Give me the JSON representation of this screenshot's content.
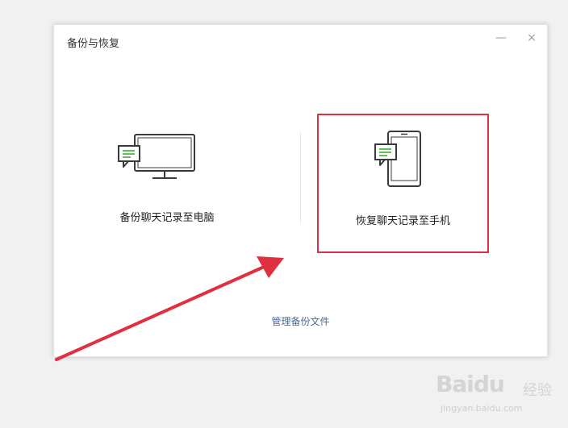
{
  "window": {
    "title": "备份与恢复",
    "minimize_glyph": "—",
    "close_glyph": "×"
  },
  "options": {
    "backup": {
      "label": "备份聊天记录至电脑",
      "icon": "monitor-chat-icon"
    },
    "restore": {
      "label": "恢复聊天记录至手机",
      "icon": "phone-chat-icon",
      "highlighted": true
    }
  },
  "manage_link": "管理备份文件",
  "annotation": {
    "highlight_color": "#e0303f",
    "arrow_color": "#e0303f"
  },
  "watermark": {
    "logo": "Baidu",
    "jingyan": "经验",
    "domain": "jingyan.baidu.com"
  },
  "colors": {
    "accent_green": "#5fbf59",
    "link_blue": "#4a6a96"
  }
}
